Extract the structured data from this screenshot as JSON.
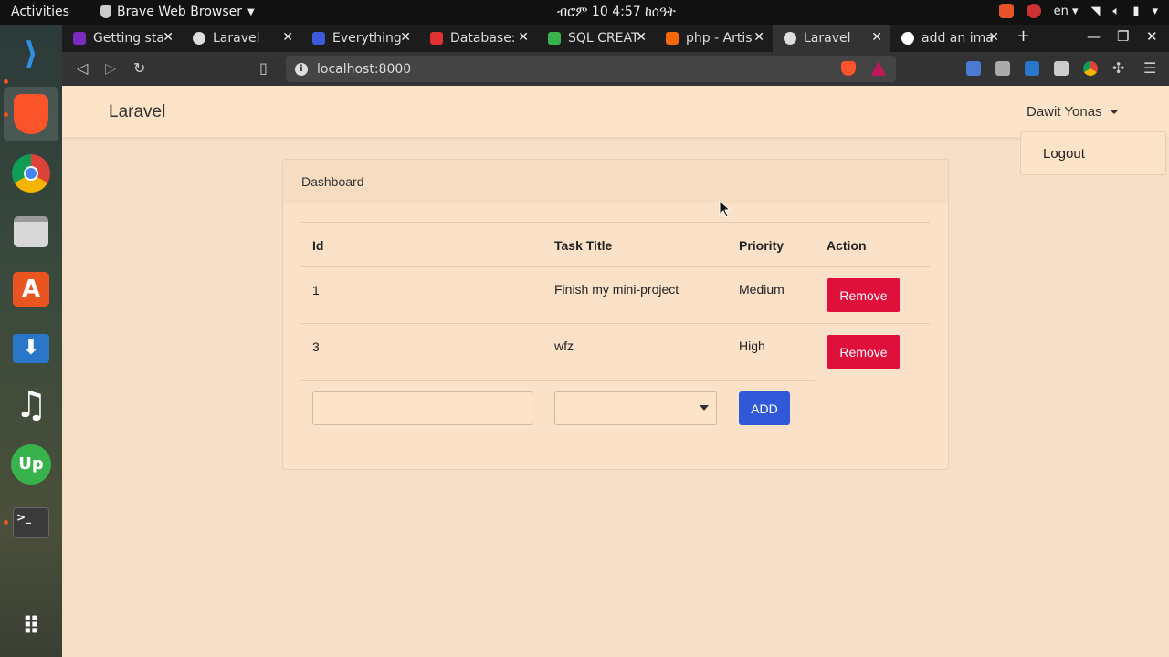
{
  "topbar": {
    "activities": "Activities",
    "app_menu": "Brave Web Browser",
    "clock": "ብሮም 10  4:57 ከሰዓት",
    "lang": "en"
  },
  "dock": {
    "items": [
      "vscode-icon",
      "brave-icon",
      "chrome-icon",
      "files-icon",
      "software-icon",
      "downloader-icon",
      "music-icon",
      "upwork-icon",
      "terminal-icon",
      "apps-grid-icon"
    ]
  },
  "browser": {
    "tabs": [
      {
        "title": "Getting sta",
        "color": "#7b2cbf"
      },
      {
        "title": "Laravel",
        "color": "#dddddd"
      },
      {
        "title": "Everything",
        "color": "#3b5bdb"
      },
      {
        "title": "Database:",
        "color": "#e03131"
      },
      {
        "title": "SQL CREAT",
        "color": "#37b24d"
      },
      {
        "title": "php - Artis",
        "color": "#f76707"
      },
      {
        "title": "Laravel",
        "color": "#dddddd",
        "active": true
      },
      {
        "title": "add an ima",
        "color": "#4285f4"
      }
    ],
    "url": "localhost:8000"
  },
  "app": {
    "brand": "Laravel",
    "user": "Dawit Yonas",
    "dropdown_item": "Logout",
    "card_title": "Dashboard",
    "table": {
      "headers": [
        "Id",
        "Task Title",
        "Priority",
        "Action"
      ],
      "rows": [
        {
          "id": "1",
          "title": "Finish my mini-project",
          "priority": "Medium",
          "action": "Remove"
        },
        {
          "id": "3",
          "title": "wfz",
          "priority": "High",
          "action": "Remove"
        }
      ]
    },
    "form": {
      "task_value": "",
      "priority_value": "",
      "add_label": "ADD"
    }
  }
}
